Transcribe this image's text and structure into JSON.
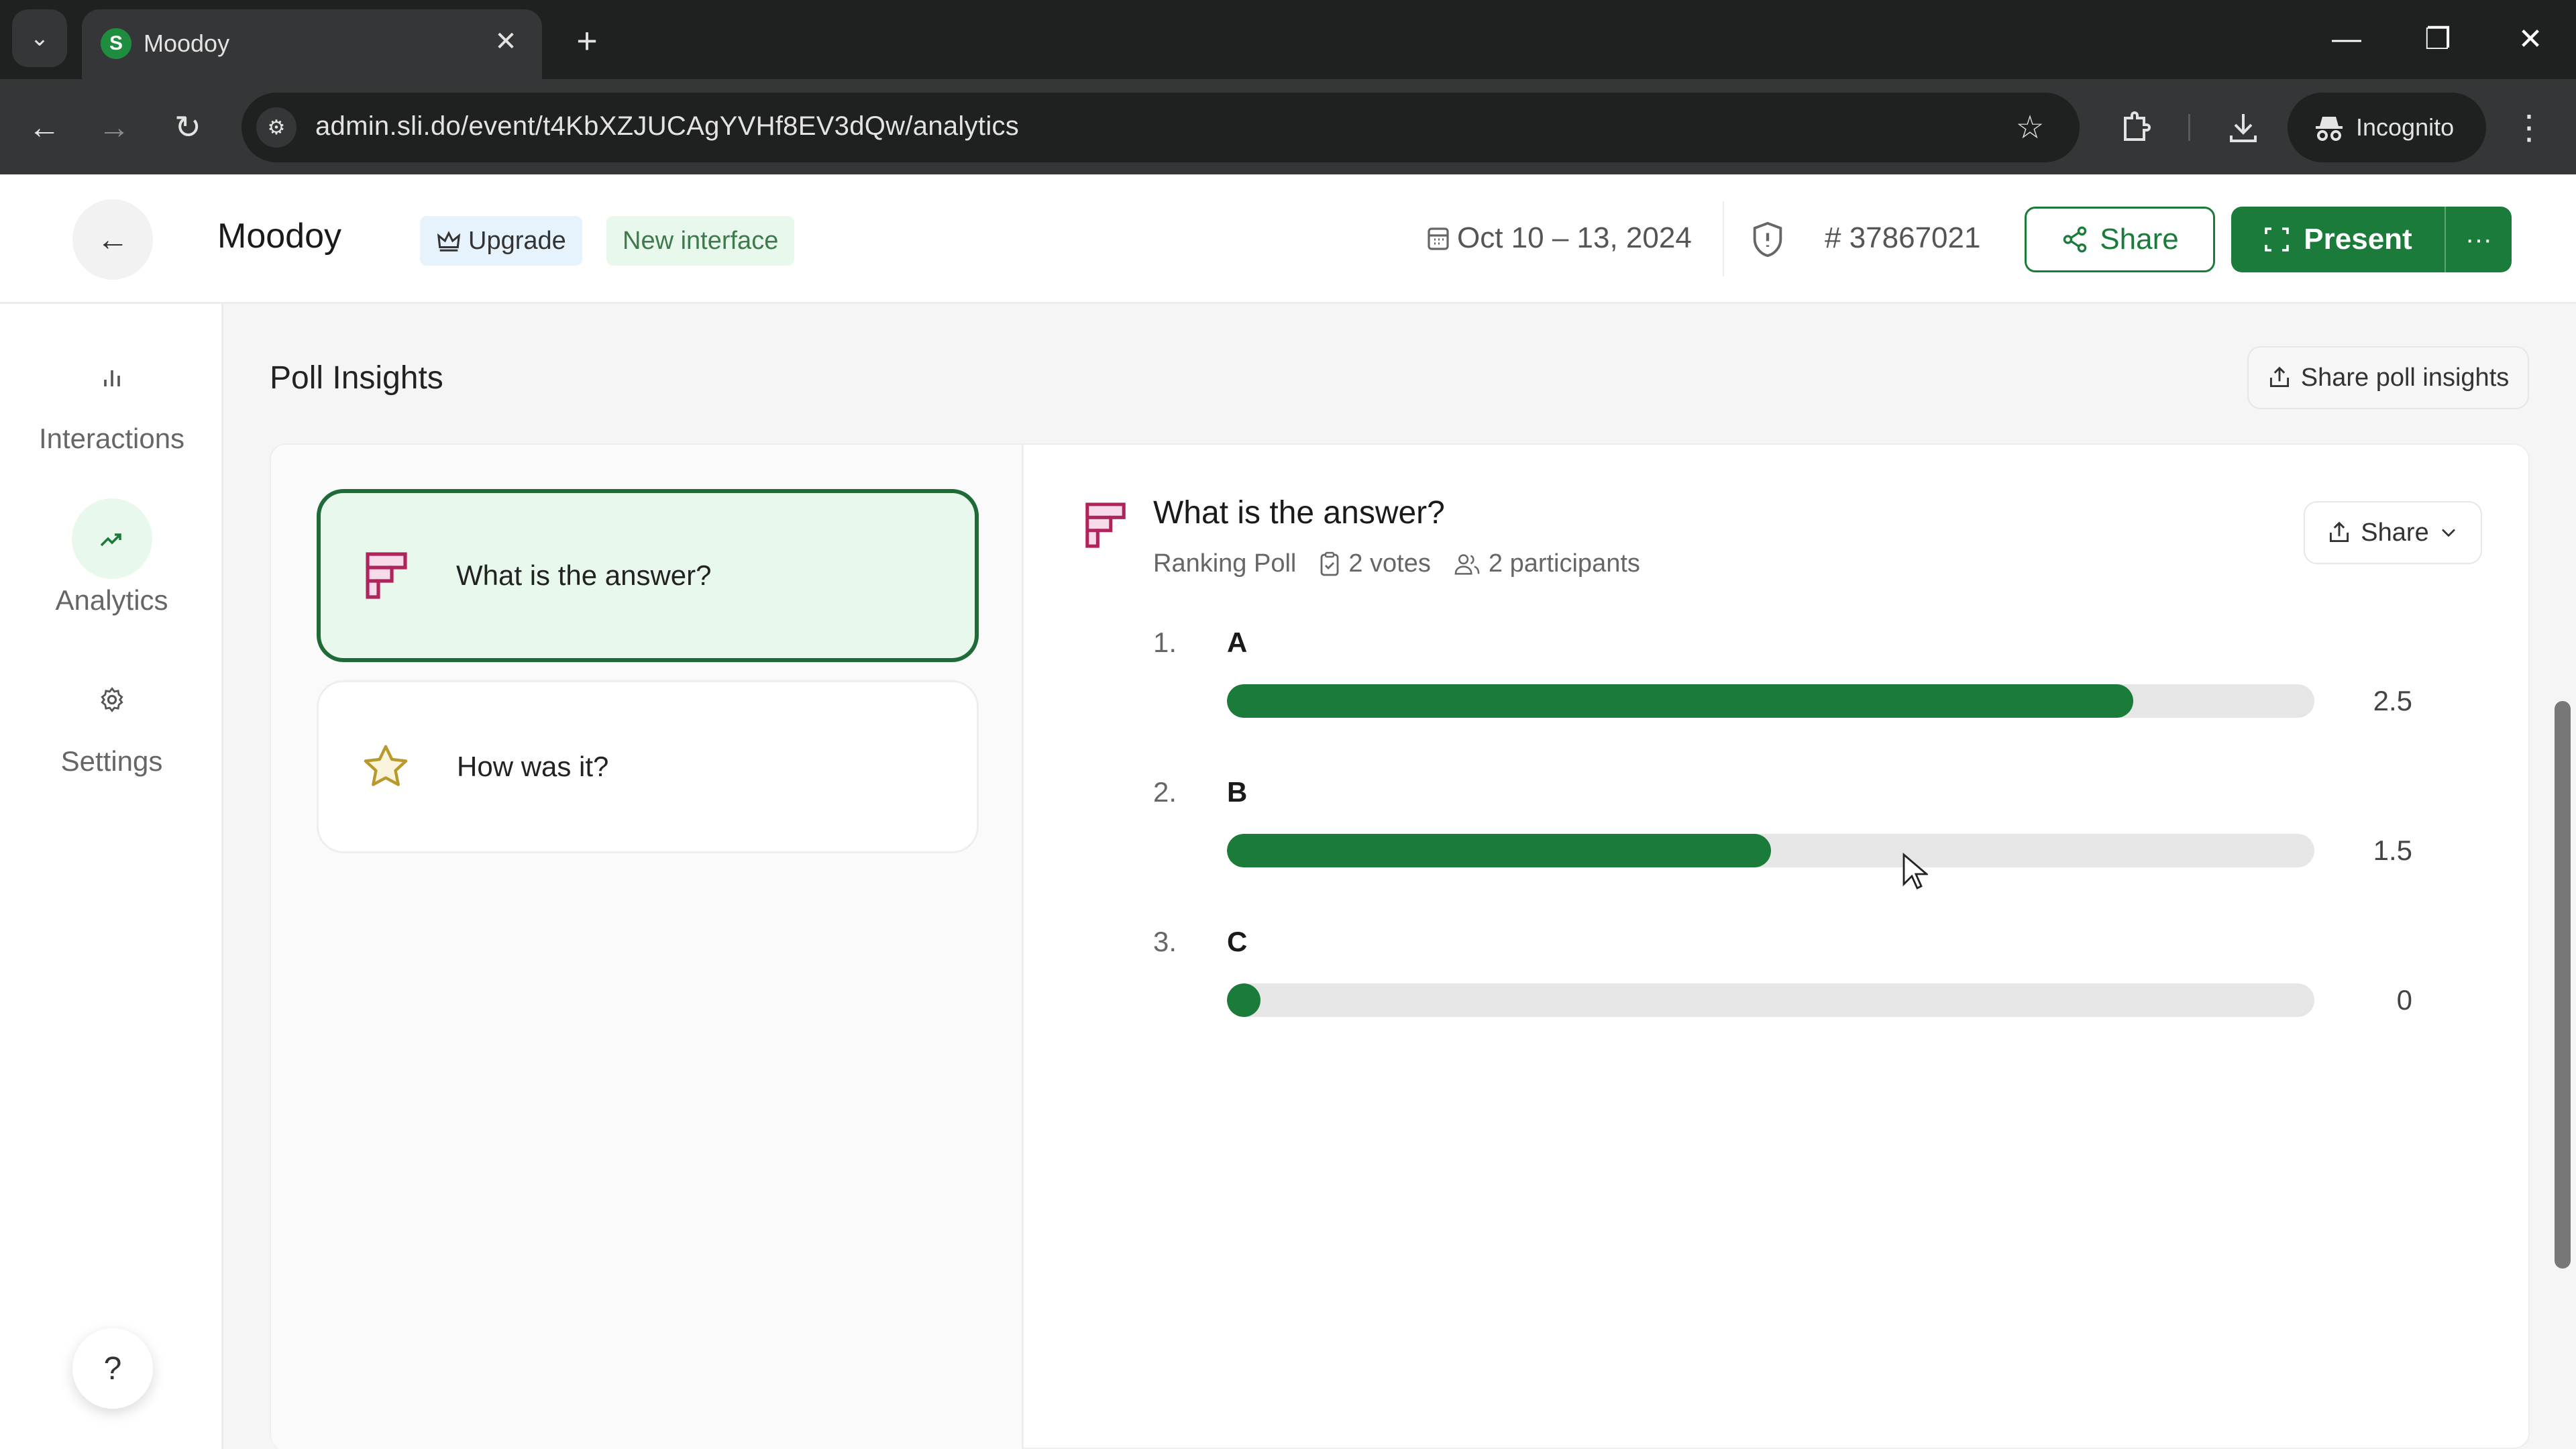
{
  "browser": {
    "tab_title": "Moodoy",
    "tab_favicon_letter": "S",
    "url": "admin.sli.do/event/t4KbXZJUCAgYVHf8EV3dQw/analytics",
    "profile_label": "Incognito",
    "icons": {
      "tab_search": "chevron-down-icon",
      "close_tab": "close-icon",
      "new_tab": "plus-icon",
      "back": "arrow-left-icon",
      "forward": "arrow-right-icon",
      "reload": "reload-icon",
      "site_info": "tune-icon",
      "bookmark": "star-icon",
      "extensions": "puzzle-icon",
      "downloads": "download-icon",
      "menu": "kebab-icon"
    }
  },
  "header": {
    "event_title": "Moodoy",
    "upgrade_label": "Upgrade",
    "new_interface_label": "New interface",
    "date_range": "Oct 10 – 13, 2024",
    "event_code": "# 37867021",
    "share_label": "Share",
    "present_label": "Present",
    "more_label": "···"
  },
  "sidebar": {
    "items": [
      {
        "label": "Interactions",
        "icon": "bar-chart-icon",
        "active": false
      },
      {
        "label": "Analytics",
        "icon": "trending-up-icon",
        "active": true
      },
      {
        "label": "Settings",
        "icon": "gear-icon",
        "active": false
      }
    ],
    "help_label": "?"
  },
  "main": {
    "page_title": "Poll Insights",
    "share_insights_label": "Share poll insights",
    "polls": [
      {
        "title": "What is the answer?",
        "icon": "ranking-poll-icon",
        "selected": true
      },
      {
        "title": "How was it?",
        "icon": "star-rating-icon",
        "selected": false
      }
    ],
    "detail": {
      "title": "What is the answer?",
      "poll_type": "Ranking Poll",
      "votes": "2 votes",
      "participants": "2 participants",
      "share_label": "Share"
    }
  },
  "colors": {
    "accent": "#1b7b3a",
    "selected_bg": "#e9f8ec",
    "track": "#e6e6e6",
    "ranking_icon": "#b0245e",
    "star_icon": "#b89a2c"
  },
  "chart_data": {
    "type": "bar",
    "orientation": "horizontal",
    "title": "What is the answer?",
    "categories": [
      "A",
      "B",
      "C"
    ],
    "ranks": [
      "1.",
      "2.",
      "3."
    ],
    "values": [
      2.5,
      1.5,
      0
    ],
    "value_labels": [
      "2.5",
      "1.5",
      "0"
    ],
    "xlim": [
      0,
      3
    ],
    "grid": false,
    "legend": "none"
  }
}
